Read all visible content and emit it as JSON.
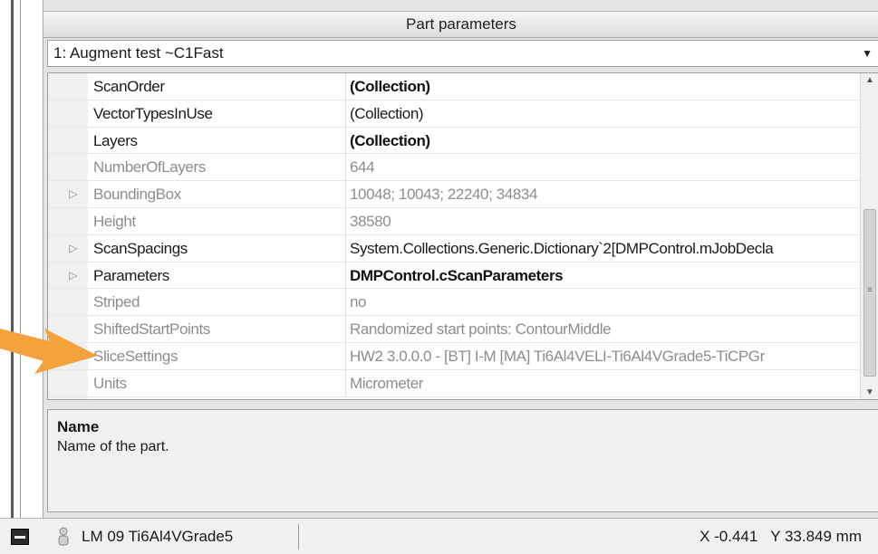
{
  "panel": {
    "title": "Part parameters",
    "selected_part": "1: Augment test ~C1Fast"
  },
  "properties": [
    {
      "name": "ScanOrder",
      "value": "(Collection)",
      "expandable": false,
      "readonly": false,
      "bold": true
    },
    {
      "name": "VectorTypesInUse",
      "value": "(Collection)",
      "expandable": false,
      "readonly": false,
      "bold": false
    },
    {
      "name": "Layers",
      "value": "(Collection)",
      "expandable": false,
      "readonly": false,
      "bold": true
    },
    {
      "name": "NumberOfLayers",
      "value": "644",
      "expandable": false,
      "readonly": true,
      "bold": false
    },
    {
      "name": "BoundingBox",
      "value": "10048; 10043; 22240; 34834",
      "expandable": true,
      "readonly": true,
      "bold": false
    },
    {
      "name": "Height",
      "value": "38580",
      "expandable": false,
      "readonly": true,
      "bold": false
    },
    {
      "name": "ScanSpacings",
      "value": "System.Collections.Generic.Dictionary`2[DMPControl.mJobDecla",
      "expandable": true,
      "readonly": false,
      "bold": false
    },
    {
      "name": "Parameters",
      "value": "DMPControl.cScanParameters",
      "expandable": true,
      "readonly": false,
      "bold": true
    },
    {
      "name": "Striped",
      "value": "no",
      "expandable": false,
      "readonly": true,
      "bold": false
    },
    {
      "name": "ShiftedStartPoints",
      "value": " Randomized start points: ContourMiddle",
      "expandable": false,
      "readonly": true,
      "bold": false
    },
    {
      "name": "SliceSettings",
      "value": "HW2 3.0.0.0 - [BT] I-M [MA] Ti6Al4VELI-Ti6Al4VGrade5-TiCPGr",
      "expandable": false,
      "readonly": true,
      "bold": false
    },
    {
      "name": "Units",
      "value": "Micrometer",
      "expandable": false,
      "readonly": true,
      "bold": false
    }
  ],
  "description": {
    "title": "Name",
    "text": "Name of the part."
  },
  "status": {
    "machine": "LM 09 Ti6Al4VGrade5",
    "coords": "X -0.441   Y 33.849 mm"
  },
  "colors": {
    "annotation_arrow": "#f4a23b",
    "readonly_text": "#8d8d8d",
    "panel_bg": "#e4e4e4"
  },
  "icons": {
    "combo_arrow": "▼",
    "expander": "▷",
    "scroll_up": "▲",
    "scroll_down": "▼"
  }
}
